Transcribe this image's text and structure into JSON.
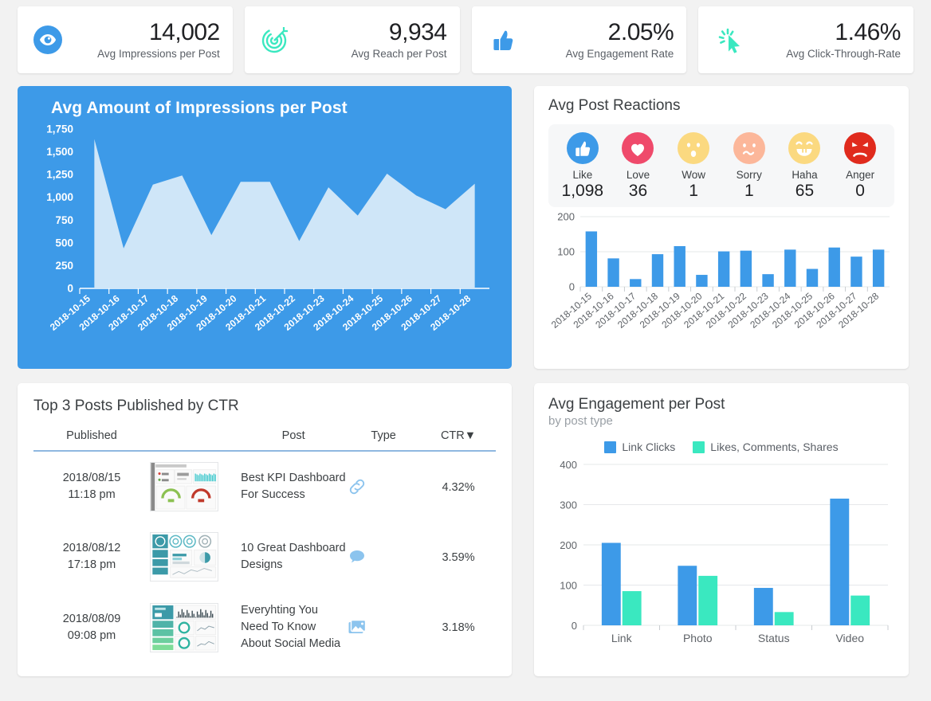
{
  "kpis": [
    {
      "icon": "eye-icon",
      "value": "14,002",
      "label": "Avg Impressions per Post",
      "color": "#3d9ae8"
    },
    {
      "icon": "target-icon",
      "value": "9,934",
      "label": "Avg Reach per Post",
      "color": "#3ae8c0"
    },
    {
      "icon": "thumbs-up-icon",
      "value": "2.05%",
      "label": "Avg Engagement Rate",
      "color": "#3d9ae8"
    },
    {
      "icon": "click-cursor-icon",
      "value": "1.46%",
      "label": "Avg Click-Through-Rate",
      "color": "#3ae8c0"
    }
  ],
  "impressions_panel": {
    "title": "Avg Amount of Impressions per Post",
    "bg_color": "#3d9ae8",
    "area_color": "#cfe6f8"
  },
  "reactions_panel": {
    "title": "Avg Post Reactions",
    "items": [
      {
        "name": "Like",
        "value": "1,098",
        "icon": "thumbs-up-reaction-icon",
        "color": "#3d9ae8"
      },
      {
        "name": "Love",
        "value": "36",
        "icon": "heart-reaction-icon",
        "color": "#ef4a6b"
      },
      {
        "name": "Wow",
        "value": "1",
        "icon": "wow-face-icon",
        "color": "#fbd980"
      },
      {
        "name": "Sorry",
        "value": "1",
        "icon": "sorry-face-icon",
        "color": "#fcb79a"
      },
      {
        "name": "Haha",
        "value": "65",
        "icon": "haha-face-icon",
        "color": "#fbd980"
      },
      {
        "name": "Anger",
        "value": "0",
        "icon": "angry-face-icon",
        "color": "#e02b1d"
      }
    ]
  },
  "table_panel": {
    "title": "Top 3 Posts Published by CTR",
    "columns": [
      "Published",
      "Post",
      "Type",
      "CTR"
    ],
    "sort_indicator": "▼",
    "rows": [
      {
        "published_date": "2018/08/15",
        "published_time": "11:18 pm",
        "post": "Best KPI Dashboard For Success",
        "type": "link-icon",
        "ctr": "4.32%",
        "thumbnail": "kpi-dashboard-thumbnail"
      },
      {
        "published_date": "2018/08/12",
        "published_time": "17:18 pm",
        "post": "10 Great Dashboard Designs",
        "type": "comment-icon",
        "ctr": "3.59%",
        "thumbnail": "dashboard-designs-thumbnail"
      },
      {
        "published_date": "2018/08/09",
        "published_time": "09:08 pm",
        "post": "Everyhting You Need To Know About Social Media",
        "type": "photo-icon",
        "ctr": "3.18%",
        "thumbnail": "social-media-thumbnail"
      }
    ]
  },
  "engagement_panel": {
    "title": "Avg Engagement per Post",
    "subtitle": "by post type"
  },
  "chart_data": [
    {
      "type": "area",
      "title": "Avg Amount of Impressions per Post",
      "xlabel": "",
      "ylabel": "",
      "ylim": [
        0,
        1750
      ],
      "yticks": [
        "0",
        "250",
        "500",
        "750",
        "1,000",
        "1,250",
        "1,500",
        "1,750"
      ],
      "grid": false,
      "categories": [
        "2018-10-15",
        "2018-10-16",
        "2018-10-17",
        "2018-10-18",
        "2018-10-19",
        "2018-10-20",
        "2018-10-21",
        "2018-10-22",
        "2018-10-23",
        "2018-10-24",
        "2018-10-25",
        "2018-10-26",
        "2018-10-27",
        "2018-10-28"
      ],
      "values": [
        1640,
        440,
        1140,
        1240,
        585,
        1170,
        1170,
        520,
        1110,
        800,
        1260,
        1020,
        870,
        1150
      ],
      "series_color": "#cfe6f8",
      "background": "#3d9ae8"
    },
    {
      "type": "bar",
      "title": "Avg Post Reactions",
      "xlabel": "",
      "ylabel": "",
      "ylim": [
        0,
        200
      ],
      "yticks": [
        "0",
        "100",
        "200"
      ],
      "grid": true,
      "categories": [
        "2018-10-15",
        "2018-10-16",
        "2018-10-17",
        "2018-10-18",
        "2018-10-19",
        "2018-10-20",
        "2018-10-21",
        "2018-10-22",
        "2018-10-23",
        "2018-10-24",
        "2018-10-25",
        "2018-10-26",
        "2018-10-27",
        "2018-10-28"
      ],
      "values": [
        158,
        81,
        22,
        93,
        116,
        34,
        101,
        103,
        36,
        106,
        51,
        112,
        86,
        106
      ],
      "series_color": "#3d9ae8"
    },
    {
      "type": "bar",
      "title": "Avg Engagement per Post",
      "subtitle": "by post type",
      "xlabel": "",
      "ylabel": "",
      "ylim": [
        0,
        400
      ],
      "yticks": [
        "0",
        "100",
        "200",
        "300",
        "400"
      ],
      "grid": true,
      "legend_position": "top",
      "categories": [
        "Link",
        "Photo",
        "Status",
        "Video"
      ],
      "series": [
        {
          "name": "Link Clicks",
          "values": [
            205,
            148,
            93,
            315
          ],
          "color": "#3d9ae8"
        },
        {
          "name": "Likes, Comments, Shares",
          "values": [
            85,
            123,
            33,
            74
          ],
          "color": "#3ae8c0"
        }
      ]
    }
  ]
}
